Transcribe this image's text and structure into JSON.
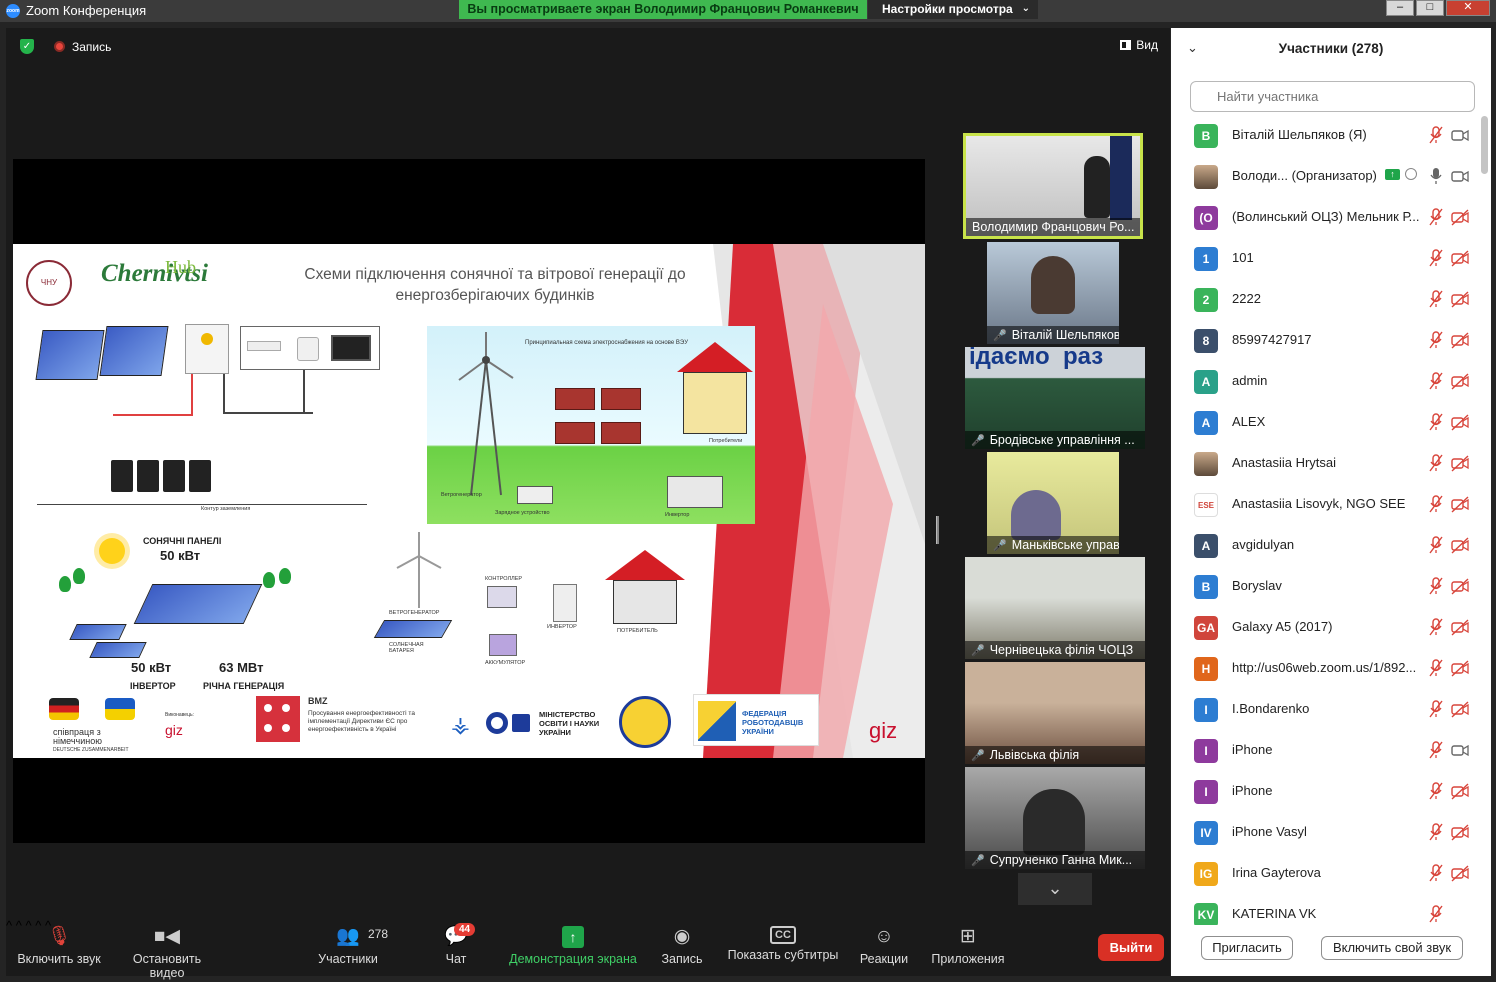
{
  "window": {
    "title": "Zoom Конференция",
    "share_banner": "Вы просматриваете экран Володимир Францович Романкевич",
    "view_options": "Настройки просмотра"
  },
  "meeting": {
    "recording_label": "Запись",
    "view_button": "Вид"
  },
  "slide": {
    "title": "Схеми підключення сонячної та вітрової генерації до енергозберігаючих будинків",
    "hub_text": "Hub",
    "logo_text": "Chernivtsi",
    "univ_logo": "ЧНУ",
    "wind_caption": "Принципиальная схема электроснабжения на основе ВЭУ",
    "wind_labels": {
      "generator": "Ветрогенератор",
      "charger": "Зарядное устройство",
      "inverter": "Инвертор",
      "consumers": "Потребители"
    },
    "contour": "Контур заземления",
    "solar_panels_label": "СОНЯЧНІ ПАНЕЛІ",
    "solar_panels_value": "50 кВт",
    "inverter_value": "50 кВт",
    "inverter_label": "ІНВЕРТОР",
    "annual_value": "63 МВт",
    "annual_label": "РІЧНА ГЕНЕРАЦІЯ",
    "hybrid_labels": {
      "wind": "ВЕТРОГЕНЕРАТОР",
      "controller": "КОНТРОЛЛЕР",
      "inverter": "ИНВЕРТОР",
      "solar": "СОЛНЕЧНАЯ БАТАРЕЯ",
      "battery": "АККУМУЛЯТОР",
      "consumer": "ПОТРЕБИТЕЛЬ"
    },
    "footer": {
      "coop": "співпраця з німеччиною",
      "coop_sub": "DEUTSCHE ZUSAMMENARBEIT",
      "giz_small": "giz",
      "giz_small_caption": "Виконавець:",
      "bmz": "BMZ",
      "bmz_text": "Просування енергоефективності та імплементації Директиви ЄС про енергоефективність в Україні",
      "ministry": "МІНІСТЕРСТВО ОСВІТИ І НАУКИ УКРАЇНИ",
      "federation": "ФЕДЕРАЦІЯ РОБОТОДАВЦІВ УКРАЇНИ",
      "giz": "giz"
    }
  },
  "video_tiles": [
    {
      "name": "Володимир Францович Ро...",
      "muted": false,
      "active": true
    },
    {
      "name": "Віталій Шельпяков",
      "muted": true,
      "active": false
    },
    {
      "name": "Бродівське управління ...",
      "muted": true,
      "active": false,
      "banner": "ідаємо  раз"
    },
    {
      "name": "Маньківське управлння",
      "muted": true,
      "active": false
    },
    {
      "name": "Чернівецька філія ЧОЦЗ",
      "muted": true,
      "active": false
    },
    {
      "name": "Львівська філія",
      "muted": true,
      "active": false
    },
    {
      "name": "Супруненко Ганна Мик...",
      "muted": true,
      "active": false
    }
  ],
  "toolbar": {
    "unmute": "Включить звук",
    "stop_video": "Остановить видео",
    "participants": "Участники",
    "participants_count": "278",
    "chat": "Чат",
    "chat_badge": "44",
    "share": "Демонстрация экрана",
    "record": "Запись",
    "captions": "Показать субтитры",
    "captions_icon": "CC",
    "reactions": "Реакции",
    "apps": "Приложения",
    "leave": "Выйти"
  },
  "participants_panel": {
    "title": "Участники (278)",
    "search_placeholder": "Найти участника",
    "invite": "Пригласить",
    "unmute_self": "Включить свой звук",
    "items": [
      {
        "initials": "В",
        "name": "Віталій Шельпяков (Я)",
        "color": "#3ab45b",
        "mic": "muted",
        "cam": "on"
      },
      {
        "initials": "",
        "name": "Володи... (Организатор)",
        "color": "#777",
        "mic": "on",
        "cam": "on",
        "photo": true,
        "sharing": true
      },
      {
        "initials": "(О",
        "name": "(Волинський ОЦЗ) Мельник Р...",
        "color": "#8e3a9d",
        "mic": "muted",
        "cam": "off"
      },
      {
        "initials": "1",
        "name": "101",
        "color": "#2d7dd2",
        "mic": "muted",
        "cam": "off"
      },
      {
        "initials": "2",
        "name": "2222",
        "color": "#3ab45b",
        "mic": "muted",
        "cam": "off"
      },
      {
        "initials": "8",
        "name": "85997427917",
        "color": "#3b4f6b",
        "mic": "muted",
        "cam": "off"
      },
      {
        "initials": "A",
        "name": "admin",
        "color": "#2aa189",
        "mic": "muted",
        "cam": "off"
      },
      {
        "initials": "A",
        "name": "ALEX",
        "color": "#2d7dd2",
        "mic": "muted",
        "cam": "off"
      },
      {
        "initials": "",
        "name": "Anastasiia Hrytsai",
        "color": "#8a6a5a",
        "mic": "muted",
        "cam": "off",
        "photo": true
      },
      {
        "initials": "ESE",
        "name": "Anastasiia Lisovyk, NGO SEE",
        "color": "#fff",
        "mic": "muted",
        "cam": "off",
        "logo": true
      },
      {
        "initials": "A",
        "name": "avgidulyan",
        "color": "#3b4f6b",
        "mic": "muted",
        "cam": "off"
      },
      {
        "initials": "B",
        "name": "Boryslav",
        "color": "#2d7dd2",
        "mic": "muted",
        "cam": "off"
      },
      {
        "initials": "GA",
        "name": "Galaxy A5 (2017)",
        "color": "#d0453b",
        "mic": "muted",
        "cam": "off"
      },
      {
        "initials": "H",
        "name": "http://us06web.zoom.us/1/892...",
        "color": "#e0661b",
        "mic": "muted",
        "cam": "off"
      },
      {
        "initials": "I",
        "name": "I.Bondarenko",
        "color": "#2d7dd2",
        "mic": "muted",
        "cam": "off"
      },
      {
        "initials": "I",
        "name": "iPhone",
        "color": "#8e3a9d",
        "mic": "muted",
        "cam": "on"
      },
      {
        "initials": "I",
        "name": "iPhone",
        "color": "#8e3a9d",
        "mic": "muted",
        "cam": "off"
      },
      {
        "initials": "IV",
        "name": "iPhone Vasyl",
        "color": "#2d7dd2",
        "mic": "muted",
        "cam": "off"
      },
      {
        "initials": "IG",
        "name": "Irina Gayterova",
        "color": "#f0a81a",
        "mic": "muted",
        "cam": "off"
      },
      {
        "initials": "KV",
        "name": "KATERINA VK",
        "color": "#3ab45b",
        "mic": "muted",
        "cam": "none"
      }
    ]
  }
}
